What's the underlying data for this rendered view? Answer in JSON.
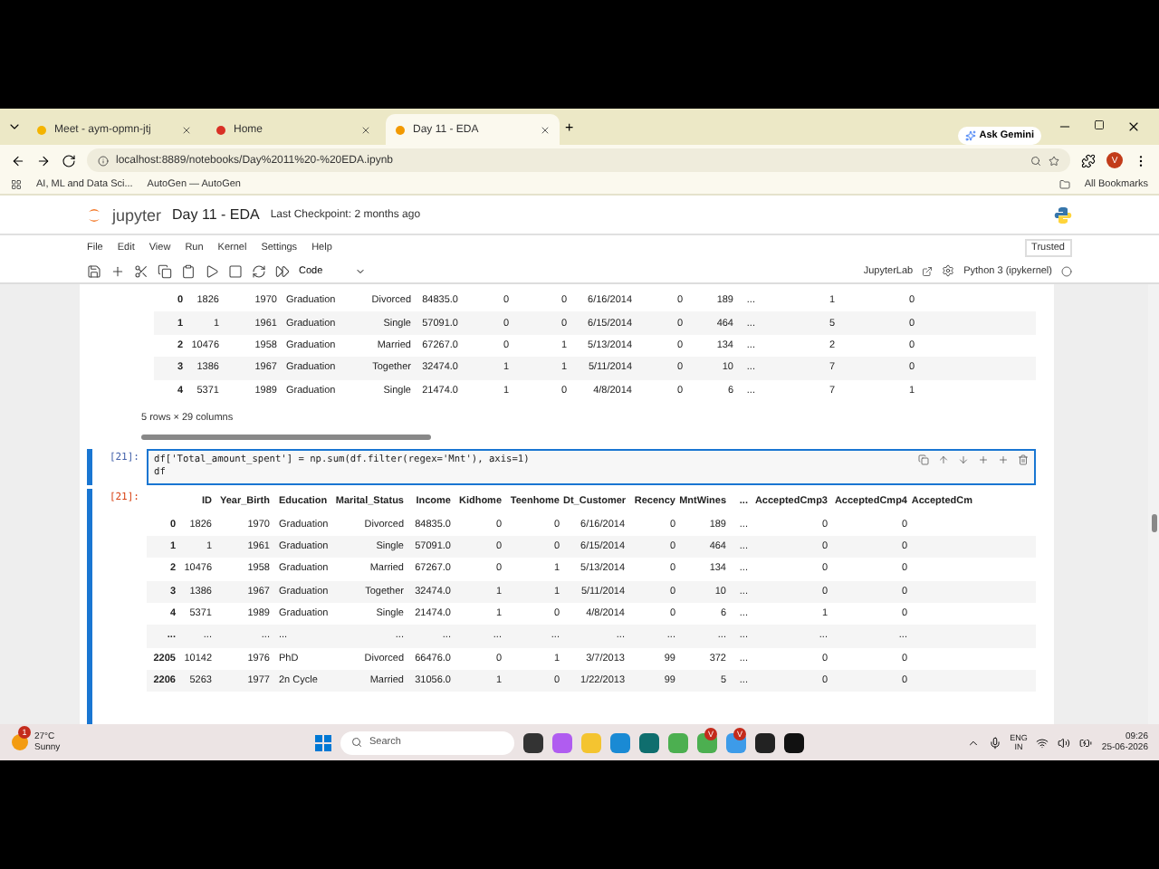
{
  "browser": {
    "tabs": [
      {
        "title": "Meet - aym-opmn-jtj",
        "selected": false
      },
      {
        "title": "Home",
        "selected": false
      },
      {
        "title": "Day 11 - EDA",
        "selected": true
      }
    ],
    "new_tab": "+",
    "ask_gemini": "Ask Gemini",
    "address": "localhost:8889/notebooks/Day%2011%20-%20EDA.ipynb",
    "profile": "V",
    "bookmarks": [
      "AI, ML and Data Sci...",
      "AutoGen — AutoGen"
    ],
    "all_bookmarks": "All Bookmarks"
  },
  "notebook": {
    "logo": "jupyter",
    "title": "Day 11 - EDA",
    "checkpoint": "Last Checkpoint: 2 months ago",
    "menu": [
      "File",
      "Edit",
      "View",
      "Run",
      "Kernel",
      "Settings",
      "Help"
    ],
    "trusted": "Trusted",
    "cell_type": "Code",
    "jupyterlab": "JupyterLab",
    "kernel": "Python 3 (ipykernel)"
  },
  "previous_output": {
    "rows": [
      [
        "0",
        "1826",
        "1970",
        "Graduation",
        "Divorced",
        "84835.0",
        "0",
        "0",
        "6/16/2014",
        "0",
        "189",
        "...",
        "1",
        "0"
      ],
      [
        "1",
        "1",
        "1961",
        "Graduation",
        "Single",
        "57091.0",
        "0",
        "0",
        "6/15/2014",
        "0",
        "464",
        "...",
        "5",
        "0"
      ],
      [
        "2",
        "10476",
        "1958",
        "Graduation",
        "Married",
        "67267.0",
        "0",
        "1",
        "5/13/2014",
        "0",
        "134",
        "...",
        "2",
        "0"
      ],
      [
        "3",
        "1386",
        "1967",
        "Graduation",
        "Together",
        "32474.0",
        "1",
        "1",
        "5/11/2014",
        "0",
        "10",
        "...",
        "7",
        "0"
      ],
      [
        "4",
        "5371",
        "1989",
        "Graduation",
        "Single",
        "21474.0",
        "1",
        "0",
        "4/8/2014",
        "0",
        "6",
        "...",
        "7",
        "1"
      ]
    ],
    "summary": "5 rows × 29 columns"
  },
  "cell": {
    "prompt": "[21]:",
    "code": [
      "df['Total_amount_spent'] = np.sum(df.filter(regex='Mnt'), axis=1)",
      "df"
    ],
    "output_prompt": "[21]:",
    "columns": [
      "",
      "ID",
      "Year_Birth",
      "Education",
      "Marital_Status",
      "Income",
      "Kidhome",
      "Teenhome",
      "Dt_Customer",
      "Recency",
      "MntWines",
      "...",
      "AcceptedCmp3",
      "AcceptedCmp4",
      "AcceptedCm"
    ],
    "rows": [
      [
        "0",
        "1826",
        "1970",
        "Graduation",
        "Divorced",
        "84835.0",
        "0",
        "0",
        "6/16/2014",
        "0",
        "189",
        "...",
        "0",
        "0"
      ],
      [
        "1",
        "1",
        "1961",
        "Graduation",
        "Single",
        "57091.0",
        "0",
        "0",
        "6/15/2014",
        "0",
        "464",
        "...",
        "0",
        "0"
      ],
      [
        "2",
        "10476",
        "1958",
        "Graduation",
        "Married",
        "67267.0",
        "0",
        "1",
        "5/13/2014",
        "0",
        "134",
        "...",
        "0",
        "0"
      ],
      [
        "3",
        "1386",
        "1967",
        "Graduation",
        "Together",
        "32474.0",
        "1",
        "1",
        "5/11/2014",
        "0",
        "10",
        "...",
        "0",
        "0"
      ],
      [
        "4",
        "5371",
        "1989",
        "Graduation",
        "Single",
        "21474.0",
        "1",
        "0",
        "4/8/2014",
        "0",
        "6",
        "...",
        "1",
        "0"
      ],
      [
        "...",
        "...",
        "...",
        "...",
        "...",
        "...",
        "...",
        "...",
        "...",
        "...",
        "...",
        "...",
        "...",
        "..."
      ],
      [
        "2205",
        "10142",
        "1976",
        "PhD",
        "Divorced",
        "66476.0",
        "0",
        "1",
        "3/7/2013",
        "99",
        "372",
        "...",
        "0",
        "0"
      ],
      [
        "2206",
        "5263",
        "1977",
        "2n Cycle",
        "Married",
        "31056.0",
        "1",
        "0",
        "1/22/2013",
        "99",
        "5",
        "...",
        "0",
        "0"
      ]
    ]
  },
  "taskbar": {
    "notification": "1",
    "temperature": "27°C",
    "weather": "Sunny",
    "search": "Search",
    "app_badges": [
      "V",
      "V"
    ],
    "language": "ENG",
    "region": "IN",
    "time": "09:26",
    "date": "25-06-2026"
  }
}
